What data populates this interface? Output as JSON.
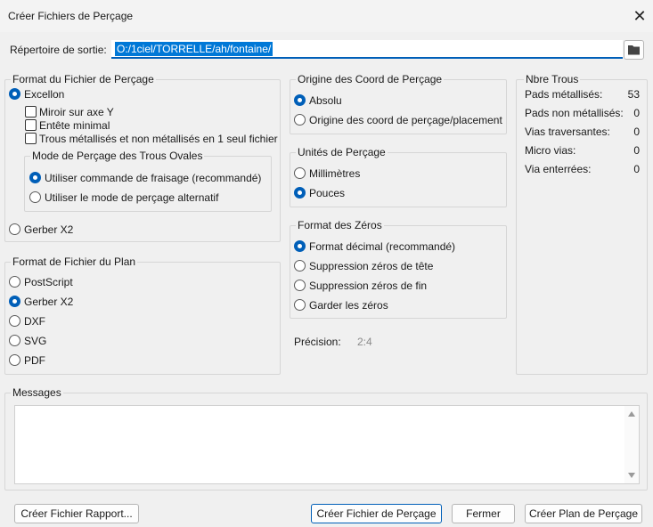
{
  "window": {
    "title": "Créer Fichiers de Perçage",
    "close_glyph": "✕"
  },
  "output": {
    "label": "Répertoire de sortie:",
    "value": "O:/1ciel/TORRELLE/ah/fontaine/"
  },
  "drill_format": {
    "title": "Format du Fichier de Perçage",
    "excellon": "Excellon",
    "mirror": "Miroir sur axe Y",
    "minimal_header": "Entête minimal",
    "merge_pth": "Trous métallisés et non métallisés en 1 seul fichier",
    "oval": {
      "title": "Mode de Perçage des Trous Ovales",
      "route": "Utiliser commande de fraisage (recommandé)",
      "alternate": "Utiliser le mode de perçage alternatif"
    },
    "gerber_x2": "Gerber X2"
  },
  "map_format": {
    "title": "Format de Fichier du Plan",
    "options": [
      "PostScript",
      "Gerber X2",
      "DXF",
      "SVG",
      "PDF"
    ]
  },
  "origin": {
    "title": "Origine des Coord de Perçage",
    "absolute": "Absolu",
    "aux": "Origine des coord de perçage/placement"
  },
  "units": {
    "title": "Unités de Perçage",
    "mm": "Millimètres",
    "inch": "Pouces"
  },
  "zeros": {
    "title": "Format des Zéros",
    "options": [
      "Format décimal (recommandé)",
      "Suppression zéros de tête",
      "Suppression zéros de fin",
      "Garder les zéros"
    ]
  },
  "precision": {
    "label": "Précision:",
    "value": "2:4"
  },
  "holes": {
    "title": "Nbre Trous",
    "rows": [
      {
        "label": "Pads métallisés:",
        "value": "53"
      },
      {
        "label": "Pads non métallisés:",
        "value": "0"
      },
      {
        "label": "Vias traversantes:",
        "value": "0"
      },
      {
        "label": "Micro vias:",
        "value": "0"
      },
      {
        "label": "Via enterrées:",
        "value": "0"
      }
    ]
  },
  "messages": {
    "title": "Messages",
    "content": ""
  },
  "buttons": {
    "report": "Créer Fichier Rapport...",
    "create_drill": "Créer Fichier de Perçage",
    "close": "Fermer",
    "create_map": "Créer Plan de Perçage"
  },
  "colors": {
    "accent": "#005fb8",
    "selection": "#0078d7"
  }
}
